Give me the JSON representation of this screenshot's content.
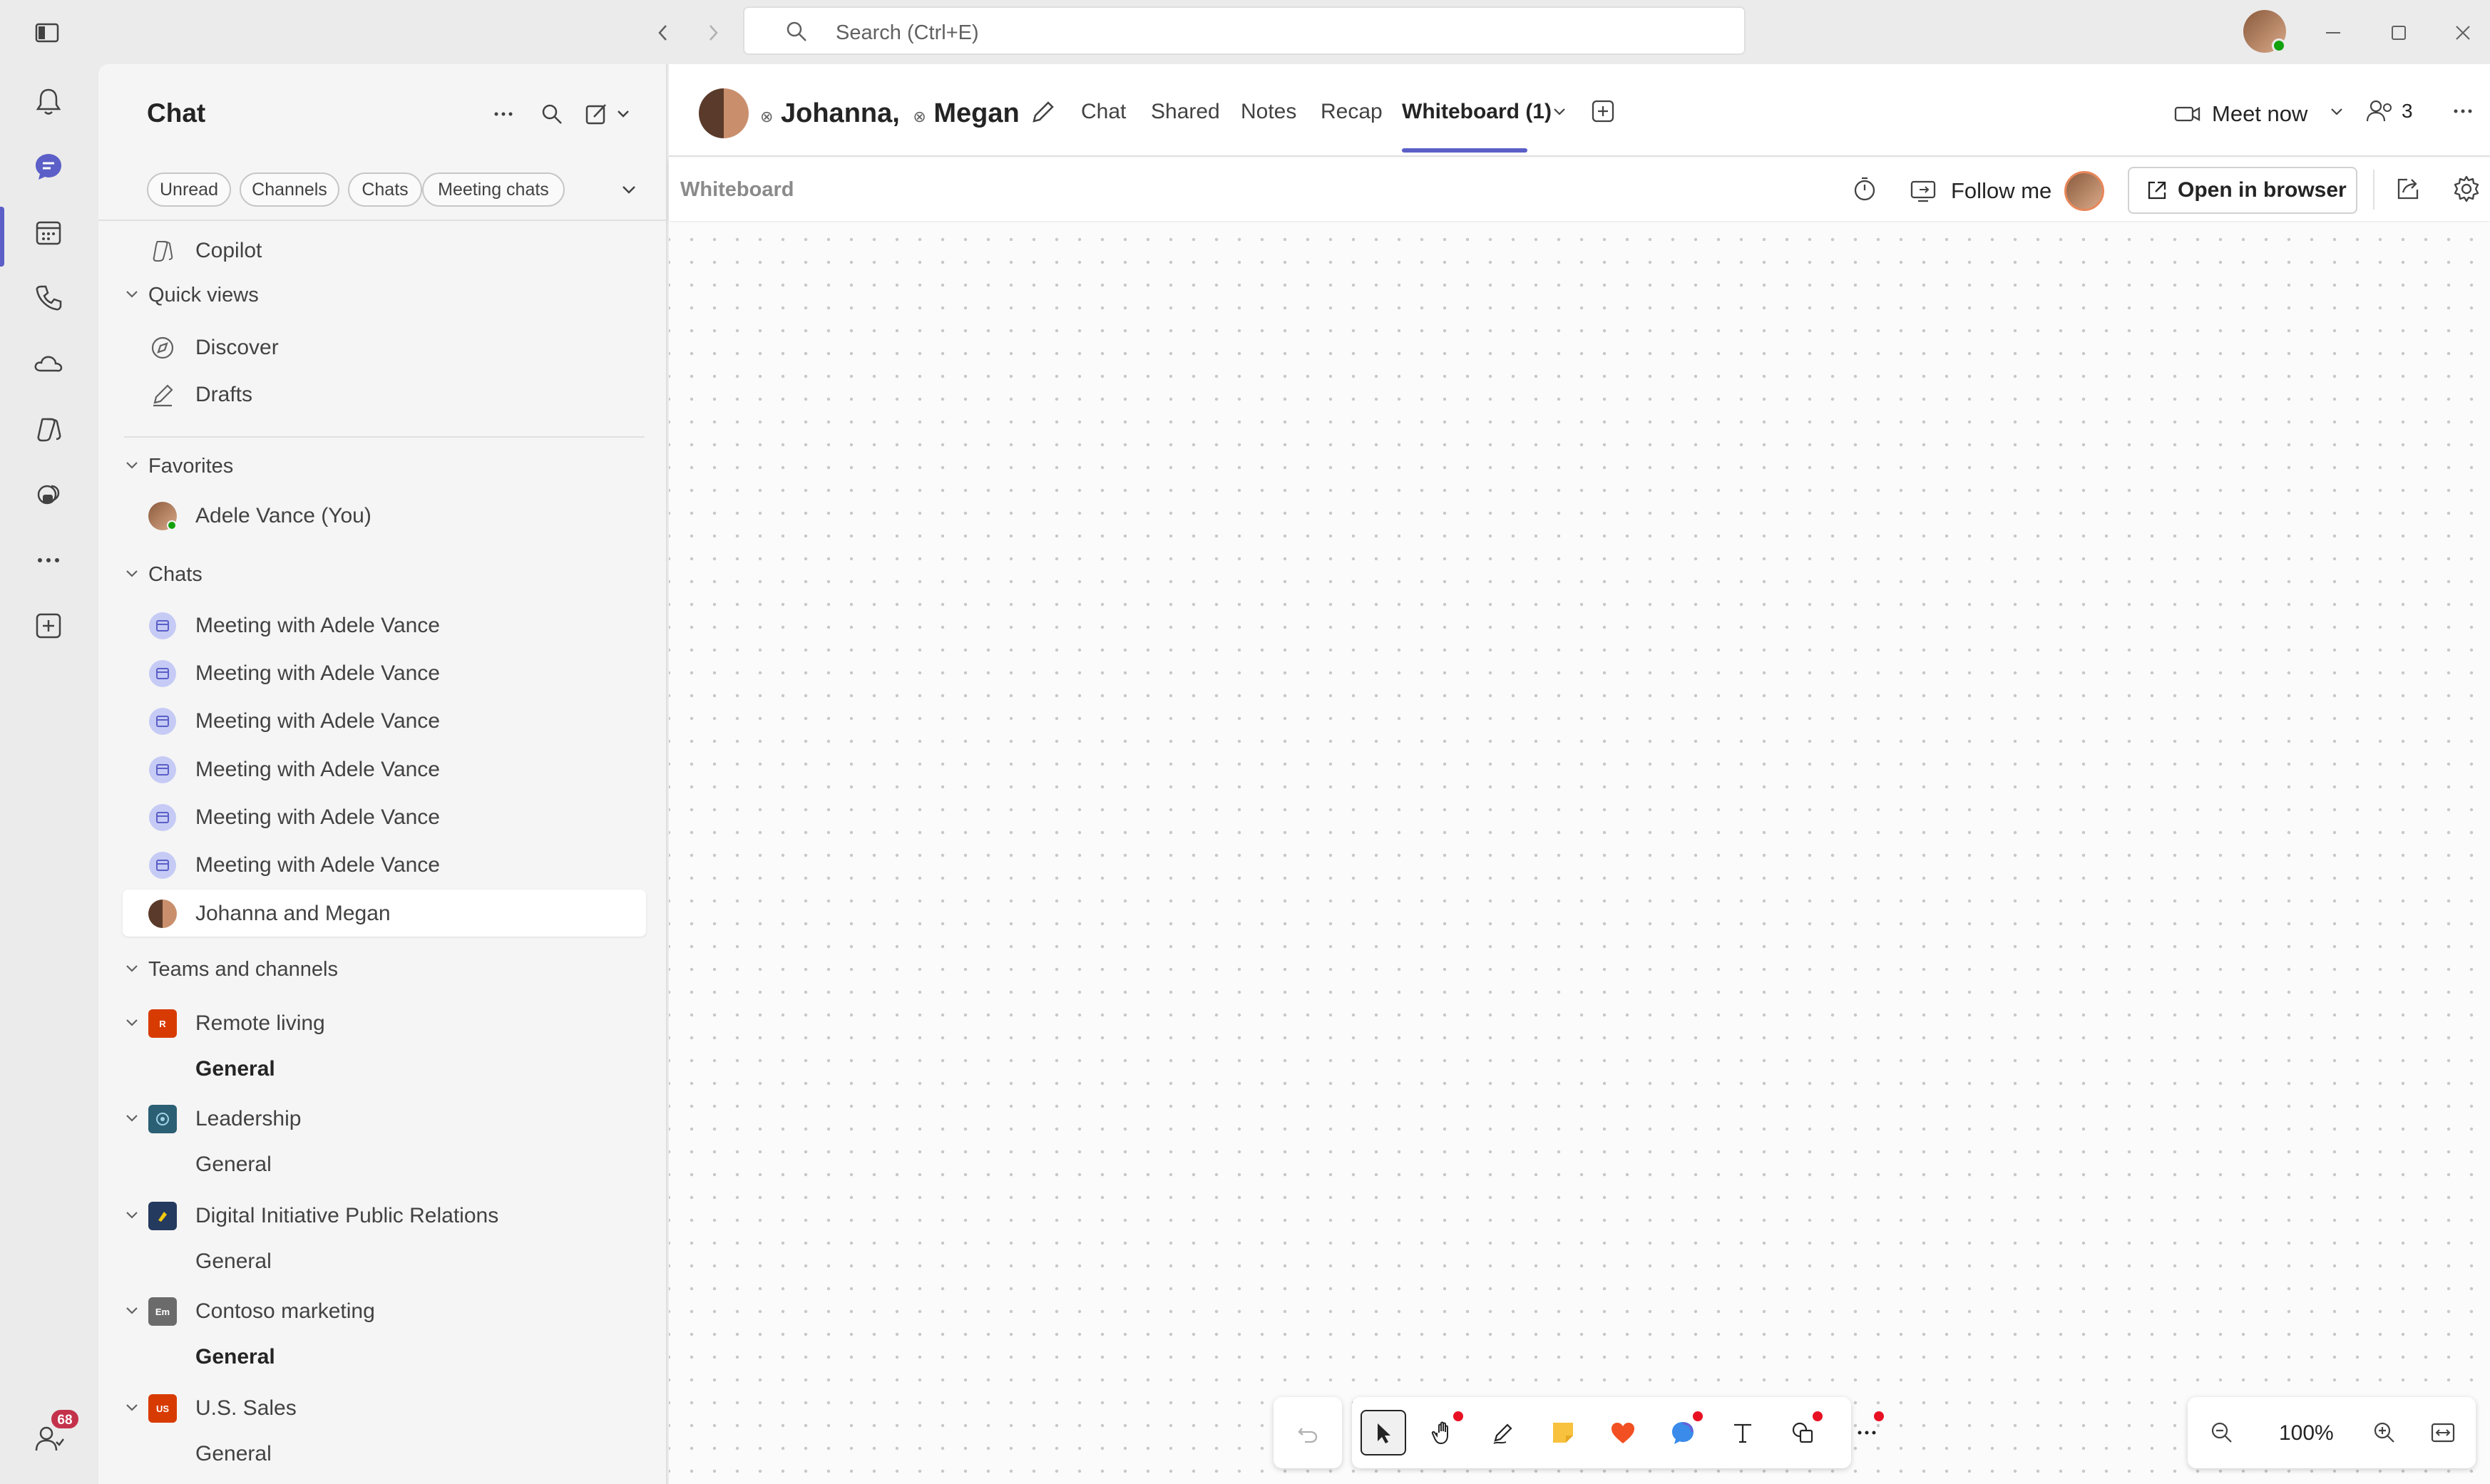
{
  "window": {
    "search_placeholder": "Search (Ctrl+E)"
  },
  "rail": {
    "items": [
      "activity-icon",
      "chat-icon",
      "calendar-icon",
      "calls-icon",
      "onedrive-icon",
      "copilot-icon",
      "apps-icon",
      "more-icon",
      "add-app-icon"
    ],
    "notification_count": "68"
  },
  "chat_panel": {
    "title": "Chat",
    "filters": [
      "Unread",
      "Channels",
      "Chats",
      "Meeting chats"
    ],
    "copilot": "Copilot",
    "quick_views": {
      "title": "Quick views",
      "items": [
        "Discover",
        "Drafts"
      ]
    },
    "favorites": {
      "title": "Favorites",
      "items": [
        "Adele Vance (You)"
      ]
    },
    "chats": {
      "title": "Chats",
      "items": [
        "Meeting with Adele Vance",
        "Meeting with Adele Vance",
        "Meeting with Adele Vance",
        "Meeting with Adele Vance",
        "Meeting with Adele Vance",
        "Meeting with Adele Vance",
        "Johanna and Megan"
      ]
    },
    "teams": {
      "title": "Teams and channels",
      "items": [
        {
          "name": "Remote living",
          "channel": "General",
          "tile_color": "#d83b01",
          "tile_text": "R"
        },
        {
          "name": "Leadership",
          "channel": "General",
          "tile_color": "#2b5f74",
          "tile_text": ""
        },
        {
          "name": "Digital Initiative Public Relations",
          "channel": "General",
          "tile_color": "#243a5e",
          "tile_text": ""
        },
        {
          "name": "Contoso marketing",
          "channel": "General",
          "tile_color": "#6b6b6b",
          "tile_text": "Em"
        },
        {
          "name": "U.S. Sales",
          "channel": "General",
          "tile_color": "#d83b01",
          "tile_text": "US"
        }
      ]
    }
  },
  "main": {
    "chat_name_1": "Johanna",
    "chat_name_sep": ",",
    "chat_name_2": "Megan",
    "tabs": [
      "Chat",
      "Shared",
      "Notes",
      "Recap",
      "Whiteboard (1)"
    ],
    "meet_now": "Meet now",
    "participants": "3",
    "whiteboard_label": "Whiteboard",
    "follow_me": "Follow me",
    "open_in_browser": "Open in browser",
    "zoom": "100%"
  },
  "colors": {
    "accent": "#5b5fc7",
    "badge": "#c4314b",
    "tool_dot": "#e81123"
  }
}
